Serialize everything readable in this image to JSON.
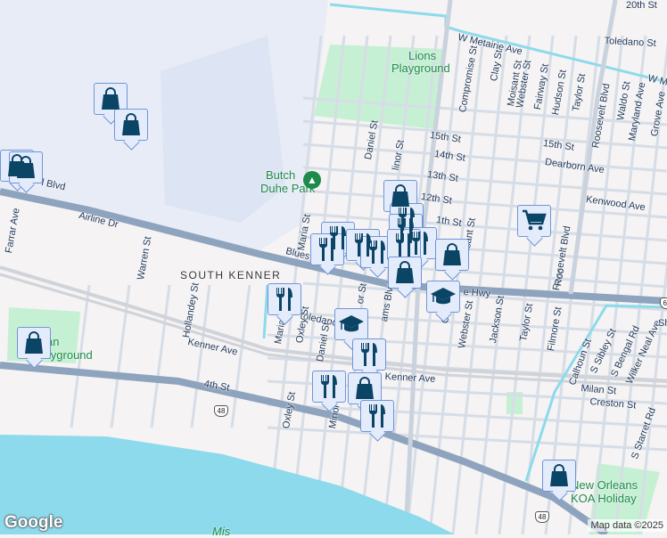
{
  "map": {
    "areas": {
      "south_kenner": "SOUTH KENNER"
    },
    "parks": {
      "butch_duhe_1": "Butch",
      "butch_duhe_2": "Duhe Park",
      "lions_1": "Lions",
      "lions_2": "Playground",
      "koa_1": "New Orleans",
      "koa_2": "KOA Holiday",
      "playground_1": "an",
      "playground_2": "Playground",
      "river": "Mis"
    },
    "streets": {
      "airline": "Airline Dr",
      "blues_hwy": "Blues Hwy",
      "blues_hwy2": "e Hwy",
      "kenner_ave": "Kenner Ave",
      "kenner_ave2": "Kenner Ave",
      "fourth": "4th St",
      "w_metairie": "W Metairie Ave",
      "w_metairie2": "W M",
      "toledano": "Toledano St",
      "toledano2": "Toledano",
      "twentieth": "20th St",
      "fifteenth": "15th St",
      "fifteenth2": "15th St",
      "fourteenth": "14th St",
      "thirteenth": "13th St",
      "twelfth": "12th St",
      "eleventh": "1th St",
      "dearborn": "Dearborn Ave",
      "kenwood": "Kenwood Ave",
      "compromise": "Compromise St",
      "clay": "Clay St",
      "moisant": "Moisant St",
      "webster": "Webster St",
      "fairway": "Fairway St",
      "hudson": "Hudson St",
      "taylor": "Taylor St",
      "roosevelt": "Roosevelt Blvd",
      "roosevelt2": "Roosevelt Blvd",
      "waldo": "Waldo St",
      "maryland": "Maryland Ave",
      "grove": "Grove Ave",
      "daniel": "Daniel St",
      "daniel2": "Daniel St",
      "minor": "linor St",
      "minor2": "Minor St",
      "maria": "Maria St",
      "maria2": "Maria St",
      "oxley": "Oxley St",
      "oxley2": "Oxley St",
      "williams": "ams Blvd",
      "clark": "Cla",
      "webster2": "Webster St",
      "moisant2": "Moisant St",
      "jackson": "Jackson St",
      "taylor2": "Taylor St",
      "filmore": "Filmore St",
      "calhoun": "Calhoun St",
      "sibley": "S Sibley St",
      "bengal": "S Bengal Rd",
      "wilker": "Wilker Neal Ave",
      "milan": "Milan St",
      "creston": "Creston St",
      "starret": "S Starret Rd",
      "warren": "Warren St",
      "hollandey": "Hollandey St",
      "farrar": "Farrar Ave",
      "blvd": "l Blvd",
      "sh": "Sh",
      "minor3": "or St",
      "roosevelt3": "Roo"
    },
    "route_shields": {
      "r48": "48",
      "r48b": "48",
      "r61": "61"
    },
    "markers": {
      "shopping": "shopping-bag",
      "restaurant": "fork-knife",
      "school": "graduation-cap",
      "grocery": "shopping-cart"
    },
    "colors": {
      "marker_fill": "#e4ecfc",
      "marker_border": "#6f95d8",
      "icon": "#0b4566",
      "highway": "#8ea3bd",
      "water": "#8ddaec",
      "park": "#c6f0d3"
    }
  },
  "footer": {
    "logo": "Google",
    "attribution": "Map data ©2025"
  }
}
